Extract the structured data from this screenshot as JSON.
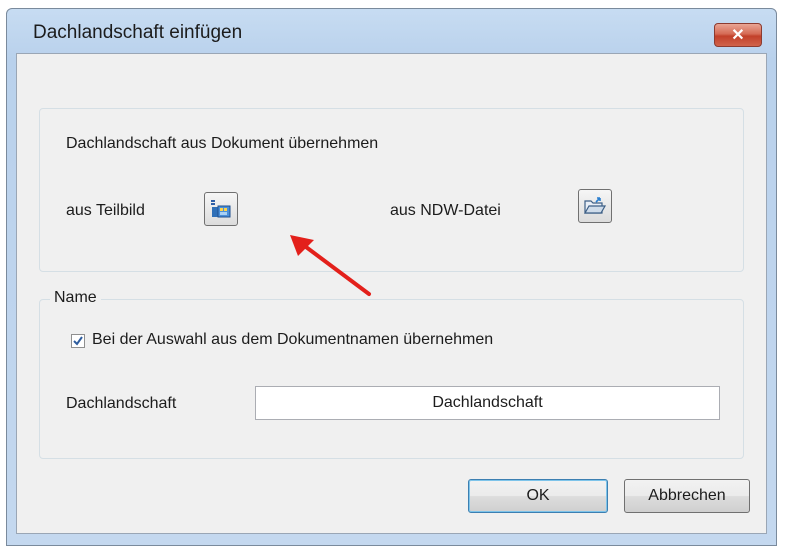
{
  "dialog": {
    "title": "Dachlandschaft einfügen",
    "close_label": "✕"
  },
  "source_group": {
    "heading": "Dachlandschaft aus Dokument übernehmen",
    "from_subdrawing_label": "aus Teilbild",
    "from_ndw_label": "aus NDW-Datei",
    "subdrawing_icon": "subdrawing-icon",
    "ndw_icon": "open-folder-icon"
  },
  "name_group": {
    "legend": "Name",
    "checkbox_label": "Bei der Auswahl aus dem Dokumentnamen übernehmen",
    "checkbox_checked": true,
    "field_label": "Dachlandschaft",
    "field_value": "Dachlandschaft"
  },
  "buttons": {
    "ok": "OK",
    "cancel": "Abbrechen"
  },
  "annotation": {
    "arrow_color": "#e3201b"
  }
}
